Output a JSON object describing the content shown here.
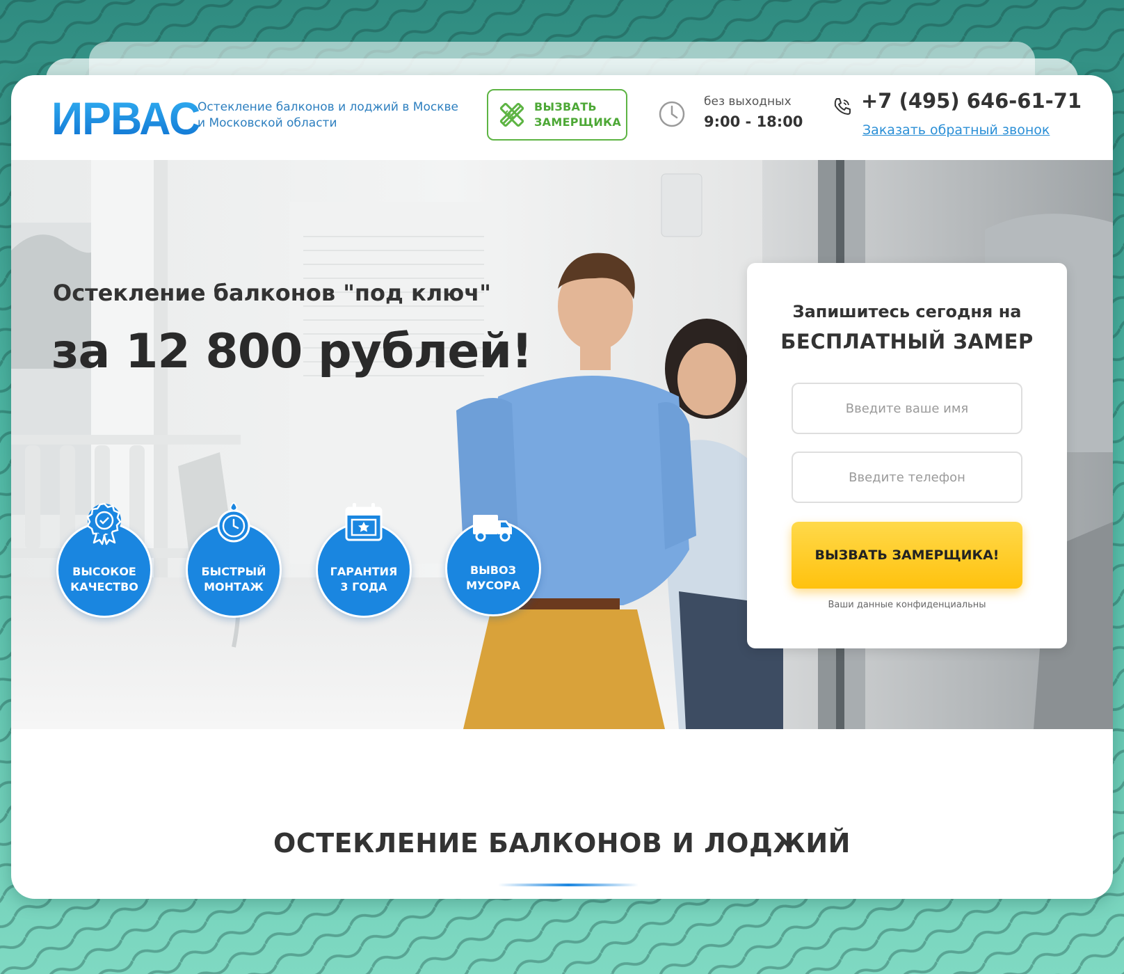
{
  "header": {
    "logo": "ИРВАС",
    "tagline_line1": "Остекление балконов и лоджий в Москве",
    "tagline_line2": "и Московской области",
    "call_button_line1": "ВЫЗВАТЬ",
    "call_button_line2": "ЗАМЕРЩИКА",
    "hours_label": "без выходных",
    "hours": "9:00 - 18:00",
    "phone": "+7 (495) 646-61-71",
    "callback_link": "Заказать обратный звонок"
  },
  "hero": {
    "title": "Остекление балконов \"под ключ\"",
    "price": "за 12 800 рублей!",
    "badges": [
      {
        "line1": "ВЫСОКОЕ",
        "line2": "КАЧЕСТВО",
        "icon": "quality-medal-icon"
      },
      {
        "line1": "БЫСТРЫЙ",
        "line2": "МОНТАЖ",
        "icon": "stopwatch-icon"
      },
      {
        "line1": "ГАРАНТИЯ",
        "line2": "3 ГОДА",
        "icon": "calendar-star-icon"
      },
      {
        "line1": "ВЫВОЗ",
        "line2": "МУСОРА",
        "icon": "truck-icon"
      }
    ]
  },
  "form": {
    "title_line1": "Запишитесь сегодня на",
    "title_line2": "БЕСПЛАТНЫЙ ЗАМЕР",
    "name_placeholder": "Введите ваше имя",
    "phone_placeholder": "Введите телефон",
    "submit_label": "ВЫЗВАТЬ ЗАМЕРЩИКА!",
    "privacy_note": "Ваши данные конфиденциальны"
  },
  "section": {
    "title": "ОСТЕКЛЕНИЕ БАЛКОНОВ И ЛОДЖИЙ"
  },
  "colors": {
    "brand_blue": "#1a86e0",
    "accent_green": "#5db443",
    "cta_yellow": "#ffc20e",
    "background_teal": "#3a9d8e"
  }
}
